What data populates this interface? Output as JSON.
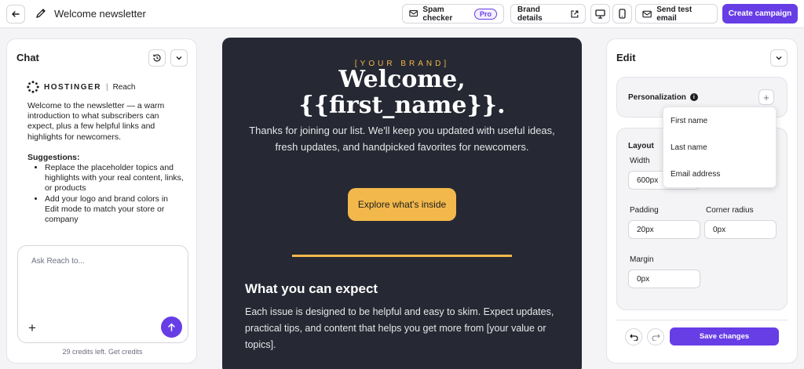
{
  "topbar": {
    "title": "Welcome newsletter",
    "spam_checker": "Spam checker",
    "pro_badge": "Pro",
    "brand_details": "Brand details",
    "send_test": "Send test email",
    "create_campaign": "Create campaign"
  },
  "chat": {
    "title": "Chat",
    "brand_name": "HOSTINGER",
    "brand_product": "Reach",
    "message": "Welcome to the newsletter — a warm introduction to what subscribers can expect, plus a few helpful links and highlights for newcomers.",
    "suggestions_heading": "Suggestions:",
    "suggestions": [
      "Replace the placeholder topics and highlights with your real content, links, or products",
      "Add your logo and brand colors in Edit mode to match your store or company"
    ],
    "input_placeholder": "Ask Reach to...",
    "credits": "29 credits left. Get credits"
  },
  "email": {
    "kicker": "[YOUR BRAND]",
    "headline_line1": "Welcome,",
    "headline_line2": "{{first_name}}.",
    "intro": "Thanks for joining our list. We'll keep you updated with useful ideas, fresh updates, and handpicked favorites for newcomers.",
    "cta": "Explore what's inside",
    "section_title": "What you can expect",
    "section_body": "Each issue is designed to be helpful and easy to skim. Expect updates, practical tips, and content that helps you get more from [your value or topics].",
    "accent_color": "#f2b84b",
    "background_color": "#262833"
  },
  "edit": {
    "title": "Edit",
    "personalization": "Personalization",
    "dropdown_items": [
      "First name",
      "Last name",
      "Email address"
    ],
    "layout": "Layout",
    "width_label": "Width",
    "width_value": "600px",
    "padding_label": "Padding",
    "padding_value": "20px",
    "corner_label": "Corner radius",
    "corner_value": "0px",
    "margin_label": "Margin",
    "margin_value": "0px",
    "save": "Save changes"
  },
  "colors": {
    "accent": "#673de6"
  },
  "icons": [
    "arrow-left-icon",
    "pencil-icon",
    "mail-check-icon",
    "external-link-icon",
    "desktop-icon",
    "mobile-icon",
    "mail-icon",
    "history-icon",
    "chevron-down-icon",
    "plus-icon",
    "arrow-up-icon",
    "info-icon",
    "undo-icon",
    "redo-icon",
    "hostinger-logo-icon"
  ]
}
